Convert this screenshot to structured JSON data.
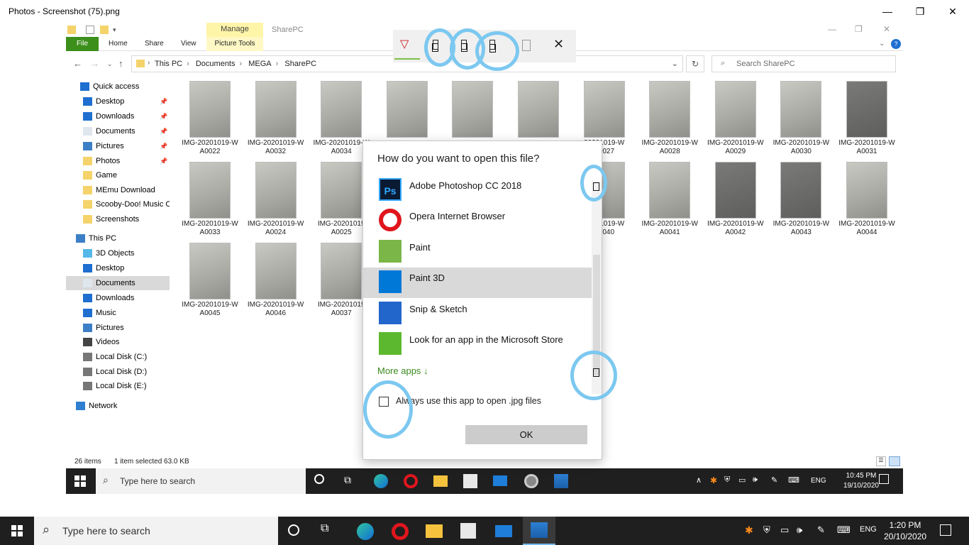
{
  "photos_window": {
    "title": "Photos - Screenshot (75).png",
    "minimize": "—",
    "maximize": "❐",
    "close": "✕"
  },
  "explorer": {
    "manage_tab": "Manage",
    "window_title": "SharePC",
    "tabs": [
      "File",
      "Home",
      "Share",
      "View",
      "Picture Tools"
    ],
    "breadcrumb": [
      "This PC",
      "Documents",
      "MEGA",
      "SharePC"
    ],
    "search_placeholder": "Search SharePC",
    "nav": [
      {
        "label": "Quick access",
        "pinned": false
      },
      {
        "label": "Desktop",
        "pinned": true
      },
      {
        "label": "Downloads",
        "pinned": true
      },
      {
        "label": "Documents",
        "pinned": true
      },
      {
        "label": "Pictures",
        "pinned": true
      },
      {
        "label": "Photos",
        "pinned": true
      },
      {
        "label": "Game",
        "pinned": false
      },
      {
        "label": "MEmu Download",
        "pinned": false
      },
      {
        "label": "Scooby-Doo! Music O",
        "pinned": false
      },
      {
        "label": "Screenshots",
        "pinned": false
      },
      {
        "label": "This PC",
        "pinned": false
      },
      {
        "label": "3D Objects",
        "pinned": false
      },
      {
        "label": "Desktop",
        "pinned": false
      },
      {
        "label": "Documents",
        "pinned": false
      },
      {
        "label": "Downloads",
        "pinned": false
      },
      {
        "label": "Music",
        "pinned": false
      },
      {
        "label": "Pictures",
        "pinned": false
      },
      {
        "label": "Videos",
        "pinned": false
      },
      {
        "label": "Local Disk (C:)",
        "pinned": false
      },
      {
        "label": "Local Disk (D:)",
        "pinned": false
      },
      {
        "label": "Local Disk (E:)",
        "pinned": false
      },
      {
        "label": "Network",
        "pinned": false
      }
    ],
    "files": [
      [
        "IMG-20201019-W",
        "A0022"
      ],
      [
        "IMG-20201019-W",
        "A0032"
      ],
      [
        "IMG-20201019-W",
        "A0034"
      ],
      [
        "",
        ""
      ],
      [
        "",
        ""
      ],
      [
        "",
        ""
      ],
      [
        "20201019-W",
        "A0027"
      ],
      [
        "IMG-20201019-W",
        "A0028"
      ],
      [
        "IMG-20201019-W",
        "A0029"
      ],
      [
        "IMG-20201019-W",
        "A0030"
      ],
      [
        "IMG-20201019-W",
        "A0031"
      ],
      [
        "IMG-20201019-W",
        "A0033"
      ],
      [
        "IMG-20201019-W",
        "A0024"
      ],
      [
        "IMG-20201019",
        "A0025"
      ],
      [
        "",
        ""
      ],
      [
        "",
        ""
      ],
      [
        "",
        ""
      ],
      [
        "20201019-W",
        "A0040"
      ],
      [
        "IMG-20201019-W",
        "A0041"
      ],
      [
        "IMG-20201019-W",
        "A0042"
      ],
      [
        "IMG-20201019-W",
        "A0043"
      ],
      [
        "IMG-20201019-W",
        "A0044"
      ],
      [
        "IMG-20201019-W",
        "A0045"
      ],
      [
        "IMG-20201019-W",
        "A0046"
      ],
      [
        "IMG-20201019",
        "A0037"
      ]
    ],
    "status_items": "26 items",
    "status_selected": "1 item selected  63.0 KB"
  },
  "dialog": {
    "title": "How do you want to open this file?",
    "apps": [
      {
        "label": "Adobe Photoshop CC 2018",
        "icon": "photoshop-icon",
        "color": "#0a1a33"
      },
      {
        "label": "Opera Internet Browser",
        "icon": "opera-icon",
        "color": "#e0161d"
      },
      {
        "label": "Paint",
        "icon": "paint-icon",
        "color": "#7ab648"
      },
      {
        "label": "Paint 3D",
        "icon": "paint3d-icon",
        "color": "#0078d7"
      },
      {
        "label": "Snip & Sketch",
        "icon": "snip-sketch-icon",
        "color": "#2266cc"
      },
      {
        "label": "Look for an app in the Microsoft Store",
        "icon": "store-icon",
        "color": "#5cb82e"
      }
    ],
    "selected_index": 3,
    "more_apps": "More apps  ↓",
    "always_label": "Always use this app to open .jpg files",
    "ok_label": "OK"
  },
  "inner_taskbar": {
    "search_text": "Type here to search",
    "time": "10:45 PM",
    "date": "19/10/2020",
    "lang": "ENG"
  },
  "taskbar": {
    "search_text": "Type here to search",
    "time": "1:20 PM",
    "date": "20/10/2020",
    "lang": "ENG"
  },
  "colors": {
    "accent": "#0078d7",
    "annotation": "#7cc8f0",
    "file_tab": "#3c8f1b",
    "more_apps": "#3a8a1e"
  }
}
